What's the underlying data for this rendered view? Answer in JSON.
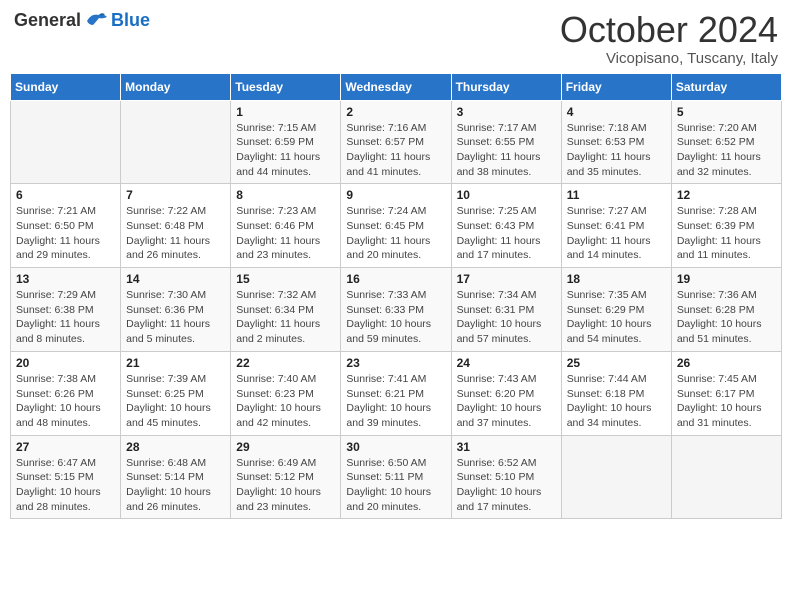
{
  "header": {
    "logo_general": "General",
    "logo_blue": "Blue",
    "month_title": "October 2024",
    "location": "Vicopisano, Tuscany, Italy"
  },
  "weekdays": [
    "Sunday",
    "Monday",
    "Tuesday",
    "Wednesday",
    "Thursday",
    "Friday",
    "Saturday"
  ],
  "weeks": [
    [
      {
        "day": "",
        "info": ""
      },
      {
        "day": "",
        "info": ""
      },
      {
        "day": "1",
        "info": "Sunrise: 7:15 AM\nSunset: 6:59 PM\nDaylight: 11 hours and 44 minutes."
      },
      {
        "day": "2",
        "info": "Sunrise: 7:16 AM\nSunset: 6:57 PM\nDaylight: 11 hours and 41 minutes."
      },
      {
        "day": "3",
        "info": "Sunrise: 7:17 AM\nSunset: 6:55 PM\nDaylight: 11 hours and 38 minutes."
      },
      {
        "day": "4",
        "info": "Sunrise: 7:18 AM\nSunset: 6:53 PM\nDaylight: 11 hours and 35 minutes."
      },
      {
        "day": "5",
        "info": "Sunrise: 7:20 AM\nSunset: 6:52 PM\nDaylight: 11 hours and 32 minutes."
      }
    ],
    [
      {
        "day": "6",
        "info": "Sunrise: 7:21 AM\nSunset: 6:50 PM\nDaylight: 11 hours and 29 minutes."
      },
      {
        "day": "7",
        "info": "Sunrise: 7:22 AM\nSunset: 6:48 PM\nDaylight: 11 hours and 26 minutes."
      },
      {
        "day": "8",
        "info": "Sunrise: 7:23 AM\nSunset: 6:46 PM\nDaylight: 11 hours and 23 minutes."
      },
      {
        "day": "9",
        "info": "Sunrise: 7:24 AM\nSunset: 6:45 PM\nDaylight: 11 hours and 20 minutes."
      },
      {
        "day": "10",
        "info": "Sunrise: 7:25 AM\nSunset: 6:43 PM\nDaylight: 11 hours and 17 minutes."
      },
      {
        "day": "11",
        "info": "Sunrise: 7:27 AM\nSunset: 6:41 PM\nDaylight: 11 hours and 14 minutes."
      },
      {
        "day": "12",
        "info": "Sunrise: 7:28 AM\nSunset: 6:39 PM\nDaylight: 11 hours and 11 minutes."
      }
    ],
    [
      {
        "day": "13",
        "info": "Sunrise: 7:29 AM\nSunset: 6:38 PM\nDaylight: 11 hours and 8 minutes."
      },
      {
        "day": "14",
        "info": "Sunrise: 7:30 AM\nSunset: 6:36 PM\nDaylight: 11 hours and 5 minutes."
      },
      {
        "day": "15",
        "info": "Sunrise: 7:32 AM\nSunset: 6:34 PM\nDaylight: 11 hours and 2 minutes."
      },
      {
        "day": "16",
        "info": "Sunrise: 7:33 AM\nSunset: 6:33 PM\nDaylight: 10 hours and 59 minutes."
      },
      {
        "day": "17",
        "info": "Sunrise: 7:34 AM\nSunset: 6:31 PM\nDaylight: 10 hours and 57 minutes."
      },
      {
        "day": "18",
        "info": "Sunrise: 7:35 AM\nSunset: 6:29 PM\nDaylight: 10 hours and 54 minutes."
      },
      {
        "day": "19",
        "info": "Sunrise: 7:36 AM\nSunset: 6:28 PM\nDaylight: 10 hours and 51 minutes."
      }
    ],
    [
      {
        "day": "20",
        "info": "Sunrise: 7:38 AM\nSunset: 6:26 PM\nDaylight: 10 hours and 48 minutes."
      },
      {
        "day": "21",
        "info": "Sunrise: 7:39 AM\nSunset: 6:25 PM\nDaylight: 10 hours and 45 minutes."
      },
      {
        "day": "22",
        "info": "Sunrise: 7:40 AM\nSunset: 6:23 PM\nDaylight: 10 hours and 42 minutes."
      },
      {
        "day": "23",
        "info": "Sunrise: 7:41 AM\nSunset: 6:21 PM\nDaylight: 10 hours and 39 minutes."
      },
      {
        "day": "24",
        "info": "Sunrise: 7:43 AM\nSunset: 6:20 PM\nDaylight: 10 hours and 37 minutes."
      },
      {
        "day": "25",
        "info": "Sunrise: 7:44 AM\nSunset: 6:18 PM\nDaylight: 10 hours and 34 minutes."
      },
      {
        "day": "26",
        "info": "Sunrise: 7:45 AM\nSunset: 6:17 PM\nDaylight: 10 hours and 31 minutes."
      }
    ],
    [
      {
        "day": "27",
        "info": "Sunrise: 6:47 AM\nSunset: 5:15 PM\nDaylight: 10 hours and 28 minutes."
      },
      {
        "day": "28",
        "info": "Sunrise: 6:48 AM\nSunset: 5:14 PM\nDaylight: 10 hours and 26 minutes."
      },
      {
        "day": "29",
        "info": "Sunrise: 6:49 AM\nSunset: 5:12 PM\nDaylight: 10 hours and 23 minutes."
      },
      {
        "day": "30",
        "info": "Sunrise: 6:50 AM\nSunset: 5:11 PM\nDaylight: 10 hours and 20 minutes."
      },
      {
        "day": "31",
        "info": "Sunrise: 6:52 AM\nSunset: 5:10 PM\nDaylight: 10 hours and 17 minutes."
      },
      {
        "day": "",
        "info": ""
      },
      {
        "day": "",
        "info": ""
      }
    ]
  ]
}
